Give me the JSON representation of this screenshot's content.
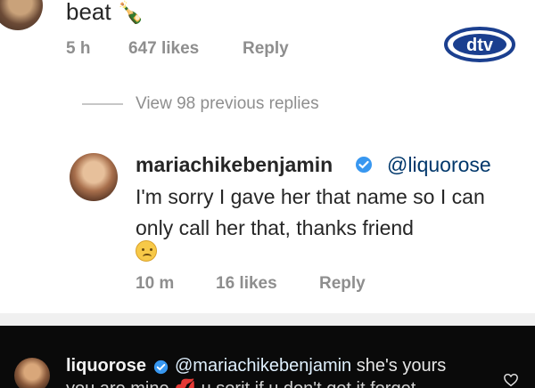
{
  "top_comment": {
    "text": "beat",
    "emoji": "🍾",
    "time": "5 h",
    "likes": "647 likes",
    "reply_label": "Reply"
  },
  "logo": {
    "text": "dtv"
  },
  "view_replies": {
    "label": "View 98 previous replies"
  },
  "reply_comment": {
    "username": "mariachikebenjamin",
    "mention": "@liquorose",
    "text": "I'm sorry I gave her that name so I can only call her that, thanks friend",
    "emoji_name": "disappointed-face",
    "time": "10 m",
    "likes": "16 likes",
    "reply_label": "Reply"
  },
  "dark_comment": {
    "username": "liquorose",
    "mention": "@mariachikebenjamin",
    "text": "she's yours",
    "line2": "you are mine 💋 u sorit if u don't got it forget"
  },
  "colors": {
    "verified": "#3897f0",
    "meta_gray": "#8e8e8e",
    "mention_blue": "#00376b",
    "dark_bg": "#0a0a0a"
  }
}
